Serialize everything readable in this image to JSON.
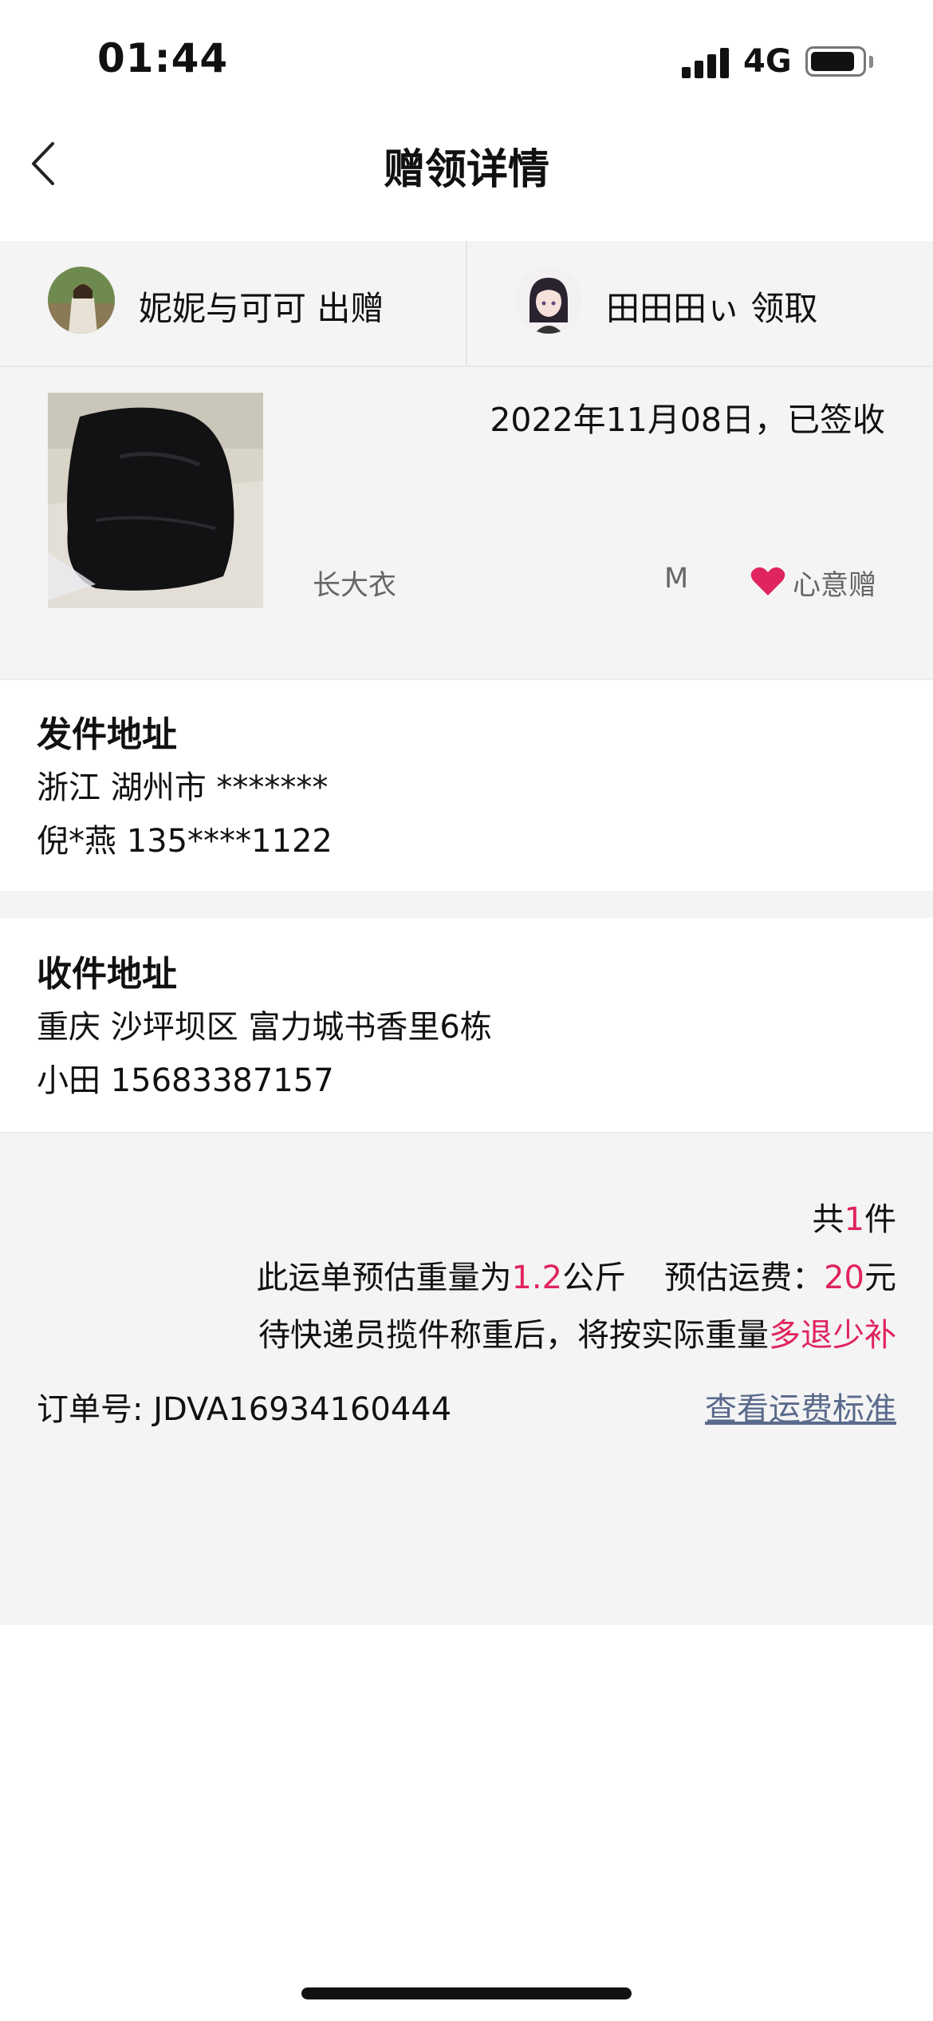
{
  "status_bar": {
    "time": "01:44",
    "network": "4G",
    "battery_level": 0.85
  },
  "nav": {
    "title": "赠领详情",
    "back_icon": "chevron-left-icon"
  },
  "parties": {
    "giver": {
      "name": "妮妮与可可",
      "action": "出赠"
    },
    "receiver": {
      "name": "田田田ぃ",
      "action": "领取"
    }
  },
  "item": {
    "status": "2022年11月08日，已签收",
    "name": "长大衣",
    "size": "M",
    "tag": "心意赠",
    "tag_icon": "heart-icon",
    "accent_color": "#e0245e"
  },
  "sender": {
    "title": "发件地址",
    "line1": "浙江 湖州市 *******",
    "line2": "倪*燕 135****1122"
  },
  "recipient": {
    "title": "收件地址",
    "line1": "重庆 沙坪坝区 富力城书香里6栋",
    "line2": "小田 15683387157"
  },
  "summary": {
    "count_prefix": "共",
    "count": "1",
    "count_suffix": "件",
    "weight_prefix": "此运单预估重量为",
    "weight": "1.2",
    "weight_unit": "公斤",
    "fee_prefix": "预估运费：",
    "fee": "20",
    "fee_unit": "元",
    "note_prefix": "待快递员揽件称重后，将按实际重量",
    "note_emphasis": "多退少补",
    "order_label": "订单号:",
    "order_no": "JDVA16934160444",
    "fee_link": "查看运费标准"
  }
}
